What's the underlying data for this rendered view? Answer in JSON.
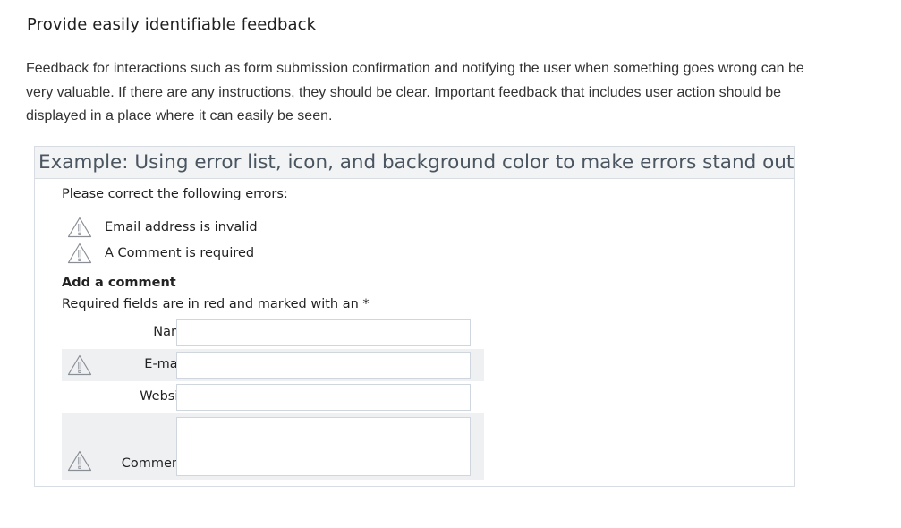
{
  "heading": "Provide easily identifiable feedback",
  "intro": "Feedback for interactions such as form submission confirmation and notifying the user when something goes wrong can be very valuable. If there are any instructions, they should be clear. Important feedback that includes user action should be displayed in a place where it can easily be seen.",
  "example": {
    "title": "Example: Using error list, icon, and background color to make errors stand out",
    "errors_intro": "Please correct the following errors:",
    "errors": [
      {
        "icon": "warning-icon",
        "text": "Email address is invalid"
      },
      {
        "icon": "warning-icon",
        "text": "A Comment is required"
      }
    ],
    "form_title": "Add a comment",
    "required_note": "Required fields are in red and marked with an *",
    "fields": {
      "name": {
        "label": "Name",
        "value": "",
        "error": false
      },
      "email": {
        "label": "E-mail*",
        "value": "",
        "error": true
      },
      "website": {
        "label": "Website",
        "value": "",
        "error": false
      },
      "comment": {
        "label": "Comment*",
        "value": "",
        "error": true
      }
    }
  },
  "colors": {
    "error_row_bg": "#eef0f2",
    "title_bg": "#f1f3f5",
    "border": "#d8dde3",
    "icon_stroke": "#8a8f96"
  }
}
